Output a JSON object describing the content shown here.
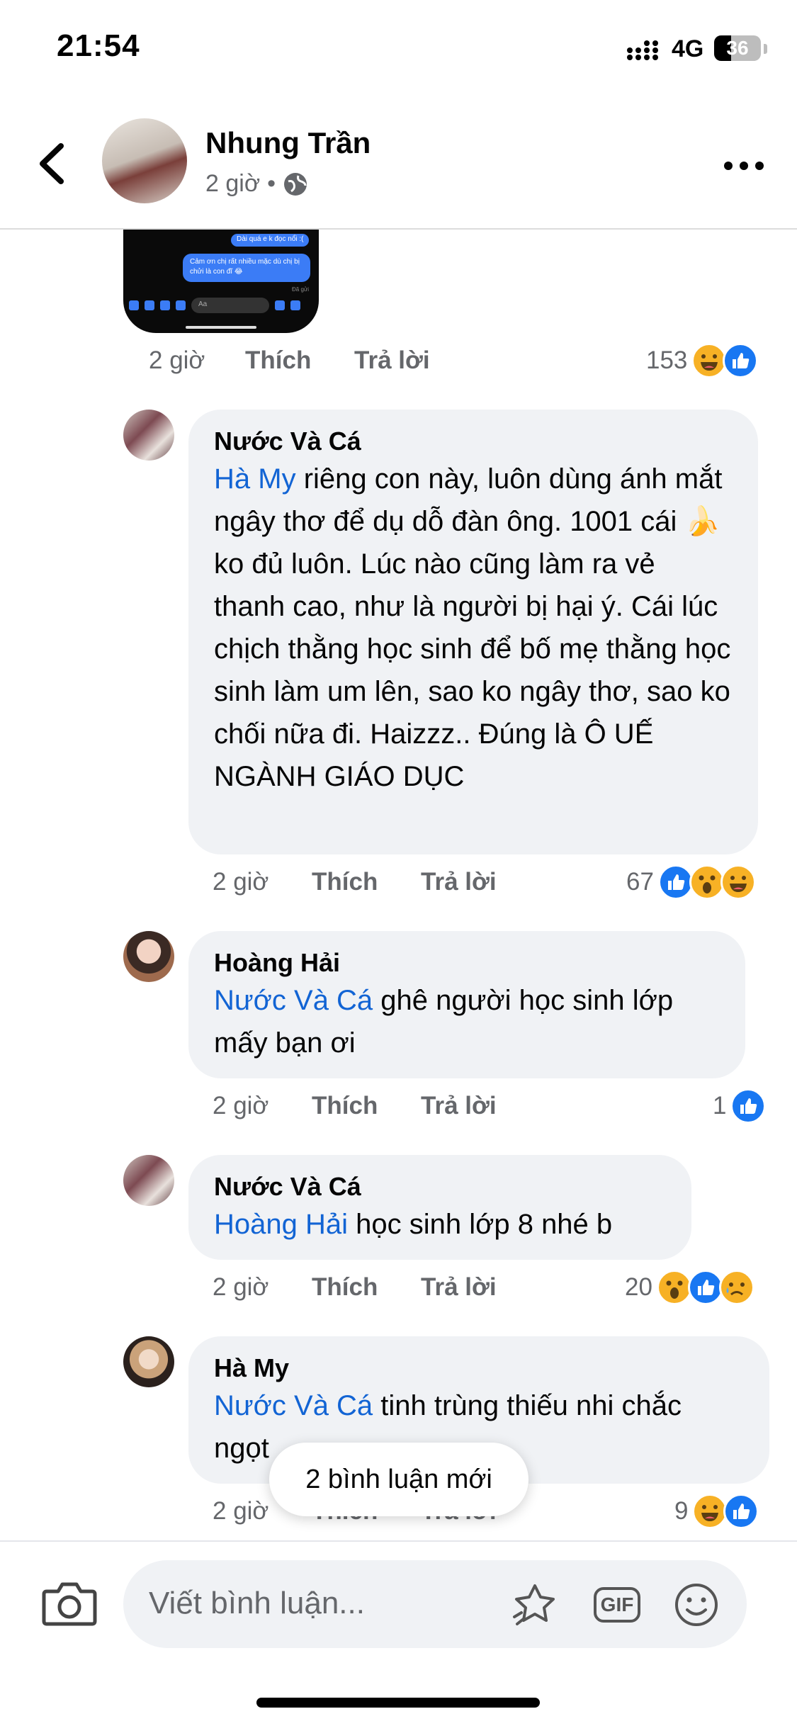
{
  "status_bar": {
    "time": "21:54",
    "network": "4G",
    "battery": "36",
    "battery_level": 0.36
  },
  "header": {
    "name": "Nhung Trần",
    "time": "2 giờ",
    "separator": "•"
  },
  "screenshot": {
    "bubble1": "Dài quá e k đọc nổi :(",
    "bubble2": "Cảm ơn chị rất nhiều mặc dù chị bị chửi là con đĩ 😂",
    "seen": "Đã gửi",
    "input_placeholder": "Aa"
  },
  "post_meta": {
    "time": "2 giờ",
    "like": "Thích",
    "reply": "Trả lời",
    "count": "153",
    "reactions": [
      "haha",
      "like"
    ]
  },
  "comments": [
    {
      "author": "Nước Và Cá",
      "mention": "Hà My",
      "text": " riêng con này, luôn dùng ánh mắt ngây thơ để dụ dỗ đàn ông. 1001 cái ",
      "emoji": "🍌",
      "text2": " ko đủ luôn. Lúc nào cũng làm ra vẻ thanh cao, như là người bị hại ý. Cái lúc chịch thằng học sinh để bố mẹ thằng học sinh làm um lên, sao ko ngây thơ, sao ko chối nữa đi. Haizzz.. Đúng là Ô UẾ NGÀNH GIÁO DỤC",
      "time": "2 giờ",
      "like": "Thích",
      "reply": "Trả lời",
      "count": "67",
      "reactions": [
        "like",
        "wow",
        "haha"
      ]
    },
    {
      "author": "Hoàng Hải",
      "mention": "Nước Và Cá",
      "text": " ghê người học sinh lớp mấy bạn ơi",
      "time": "2 giờ",
      "like": "Thích",
      "reply": "Trả lời",
      "count": "1",
      "reactions": [
        "like"
      ]
    },
    {
      "author": "Nước Và Cá",
      "mention": "Hoàng Hải",
      "text": " học sinh lớp 8 nhé b",
      "time": "2 giờ",
      "like": "Thích",
      "reply": "Trả lời",
      "count": "20",
      "reactions": [
        "wow",
        "like",
        "sad"
      ]
    },
    {
      "author": "Hà My",
      "mention": "Nước Và Cá",
      "text": " tinh trùng thiếu nhi chắc ngọt",
      "time": "2 giờ",
      "like": "Thích",
      "reply": "Trả lời",
      "count": "9",
      "reactions": [
        "haha",
        "like"
      ]
    }
  ],
  "new_comments_pill": "2 bình luận mới",
  "composer": {
    "placeholder": "Viết bình luận...",
    "gif_label": "GIF"
  }
}
